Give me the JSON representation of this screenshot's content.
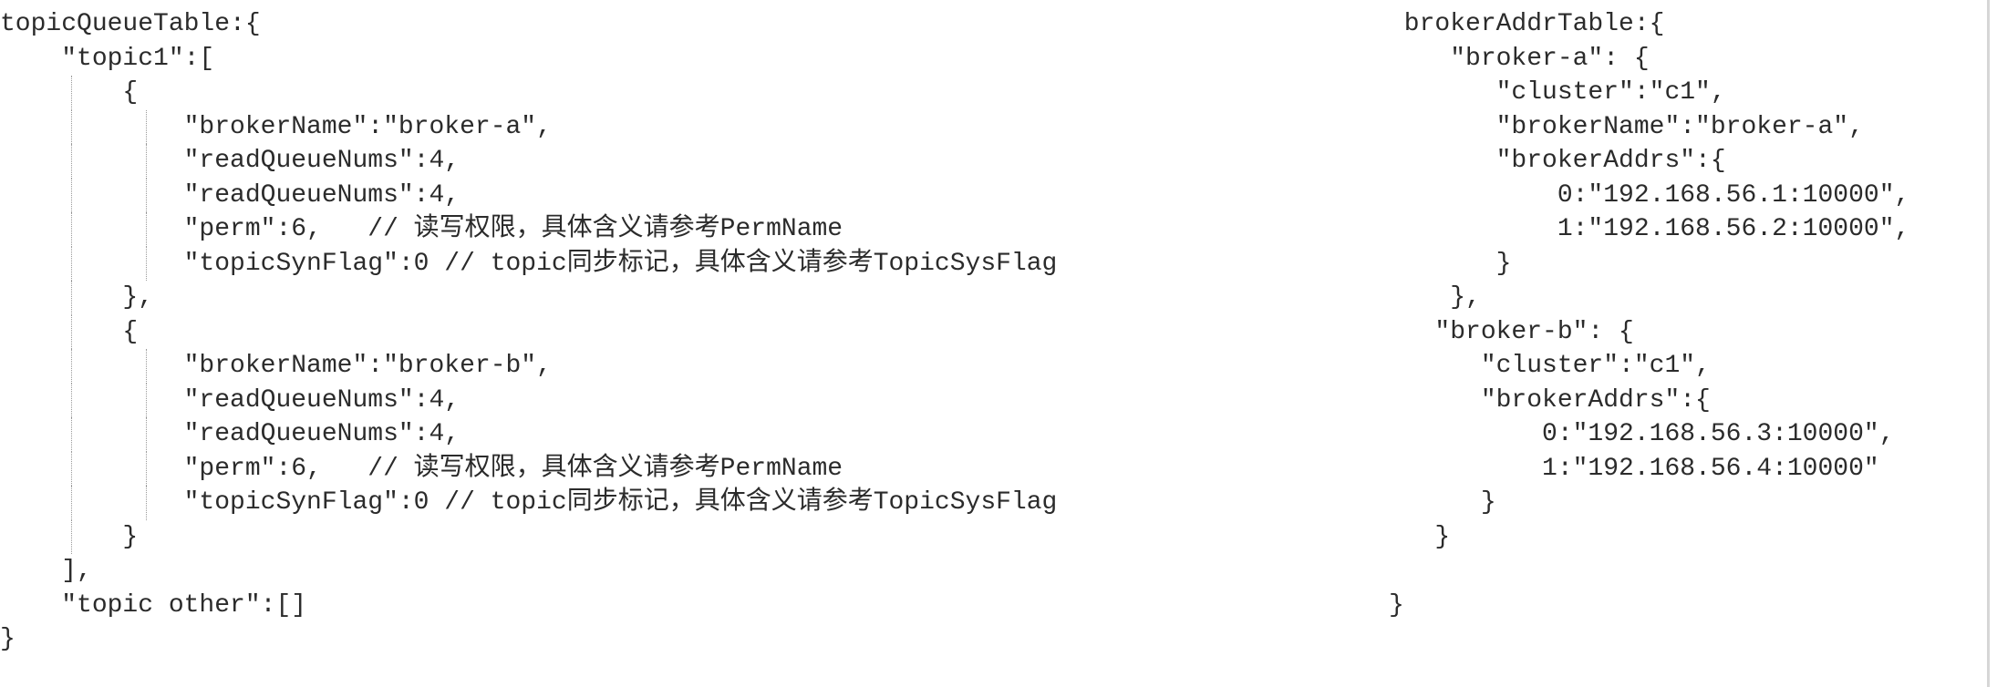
{
  "left_code": {
    "lines": [
      "topicQueueTable:{",
      "    \"topic1\":[",
      "        {",
      "            \"brokerName\":\"broker-a\",",
      "            \"readQueueNums\":4,",
      "            \"readQueueNums\":4,",
      "            \"perm\":6,   // 读写权限，具体含义请参考PermName",
      "            \"topicSynFlag\":0 // topic同步标记，具体含义请参考TopicSysFlag",
      "        },",
      "        {",
      "            \"brokerName\":\"broker-b\",",
      "            \"readQueueNums\":4,",
      "            \"readQueueNums\":4,",
      "            \"perm\":6,   // 读写权限，具体含义请参考PermName",
      "            \"topicSynFlag\":0 // topic同步标记，具体含义请参考TopicSysFlag",
      "        }",
      "    ],",
      "    \"topic other\":[]",
      "}"
    ]
  },
  "right_code": {
    "lines": [
      " brokerAddrTable:{",
      "    \"broker-a\": {",
      "       \"cluster\":\"c1\",",
      "       \"brokerName\":\"broker-a\",",
      "       \"brokerAddrs\":{",
      "           0:\"192.168.56.1:10000\",",
      "           1:\"192.168.56.2:10000\",",
      "       }",
      "    },",
      "   \"broker-b\": {",
      "      \"cluster\":\"c1\",",
      "      \"brokerAddrs\":{",
      "          0:\"192.168.56.3:10000\",",
      "          1:\"192.168.56.4:10000\"",
      "      }",
      "   }",
      "",
      "}"
    ]
  }
}
